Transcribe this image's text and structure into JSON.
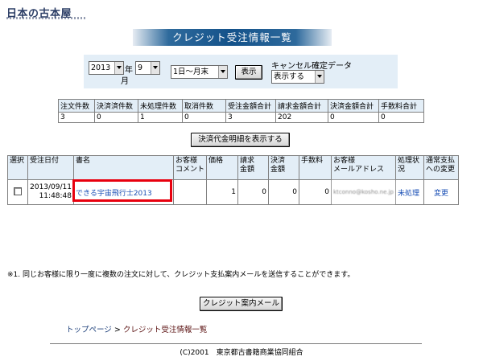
{
  "logo": {
    "text": "日本の古本屋"
  },
  "page_title": "クレジット受注情報一覧",
  "filter": {
    "year": "2013",
    "year_suffix": "年",
    "month": "9",
    "month_suffix": "月",
    "day_range": "1日～月末",
    "show_button": "表示",
    "cancel_label": "キャンセル確定データ",
    "cancel_value": "表示する"
  },
  "summary": {
    "headers": [
      "注文件数",
      "決済済件数",
      "未処理件数",
      "取消件数",
      "受注金額合計",
      "請求金額合計",
      "決済金額合計",
      "手数料合計"
    ],
    "values": [
      "3",
      "0",
      "1",
      "0",
      "3",
      "202",
      "0",
      "0"
    ]
  },
  "details_button": "決済代金明細を表示する",
  "orders": {
    "headers": [
      "選択",
      "受注日付",
      "書名",
      "お客様\nコメント",
      "価格",
      "請求\n金額",
      "決済\n金額",
      "手数料",
      "お客様\nメールアドレス",
      "処理状\n況",
      "通常支払\nへの変更"
    ],
    "rows": [
      {
        "date": "2013/09/11",
        "time": "11:48:48",
        "title": "できる宇宙飛行士2013",
        "comment": "",
        "price": "1",
        "billing": "0",
        "settlement": "0",
        "fee": "0",
        "email": "ktconno@kosho.ne.jp",
        "status": "未処理",
        "change": "変更"
      }
    ]
  },
  "note": "※1. 同じお客様に限り一度に複数の注文に対して、クレジット支払案内メールを送信することができます。",
  "guide_button": "クレジット案内メール",
  "breadcrumb": {
    "top": "トップページ",
    "sep": ">",
    "current": "クレジット受注情報一覧"
  },
  "footer": "(C)2001　東京都古書籍商業協同組合",
  "colors": {
    "header_bg": "#e3eef7",
    "banner": "#14528a",
    "link": "#1a4fb5",
    "highlight": "#e8000e"
  }
}
